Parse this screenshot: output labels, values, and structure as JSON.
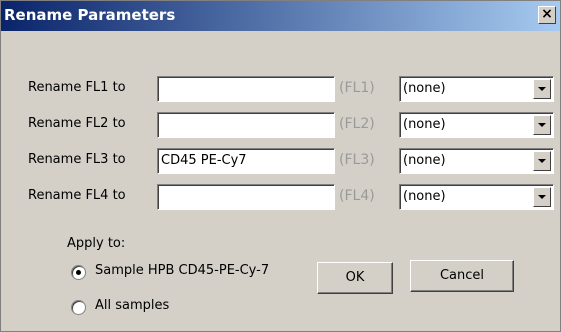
{
  "window": {
    "title": "Rename Parameters",
    "close_glyph": "×",
    "close_icon": "close-icon"
  },
  "params": [
    {
      "label": "Rename FL1 to",
      "value": "",
      "hint": "(FL1)",
      "select": "(none)"
    },
    {
      "label": "Rename FL2 to",
      "value": "",
      "hint": "(FL2)",
      "select": "(none)"
    },
    {
      "label": "Rename FL3 to",
      "value": "CD45 PE-Cy7",
      "hint": "(FL3)",
      "select": "(none)"
    },
    {
      "label": "Rename FL4 to",
      "value": "",
      "hint": "(FL4)",
      "select": "(none)"
    }
  ],
  "apply": {
    "label": "Apply to:",
    "options": [
      {
        "label": "Sample HPB CD45-PE-Cy-7",
        "selected": true
      },
      {
        "label": "All samples",
        "selected": false
      }
    ]
  },
  "buttons": {
    "ok": "OK",
    "cancel": "Cancel"
  },
  "colors": {
    "face": "#d4d0c8",
    "title_start": "#0a246a",
    "title_end": "#a6caf0",
    "hint": "#9a9a9a"
  }
}
